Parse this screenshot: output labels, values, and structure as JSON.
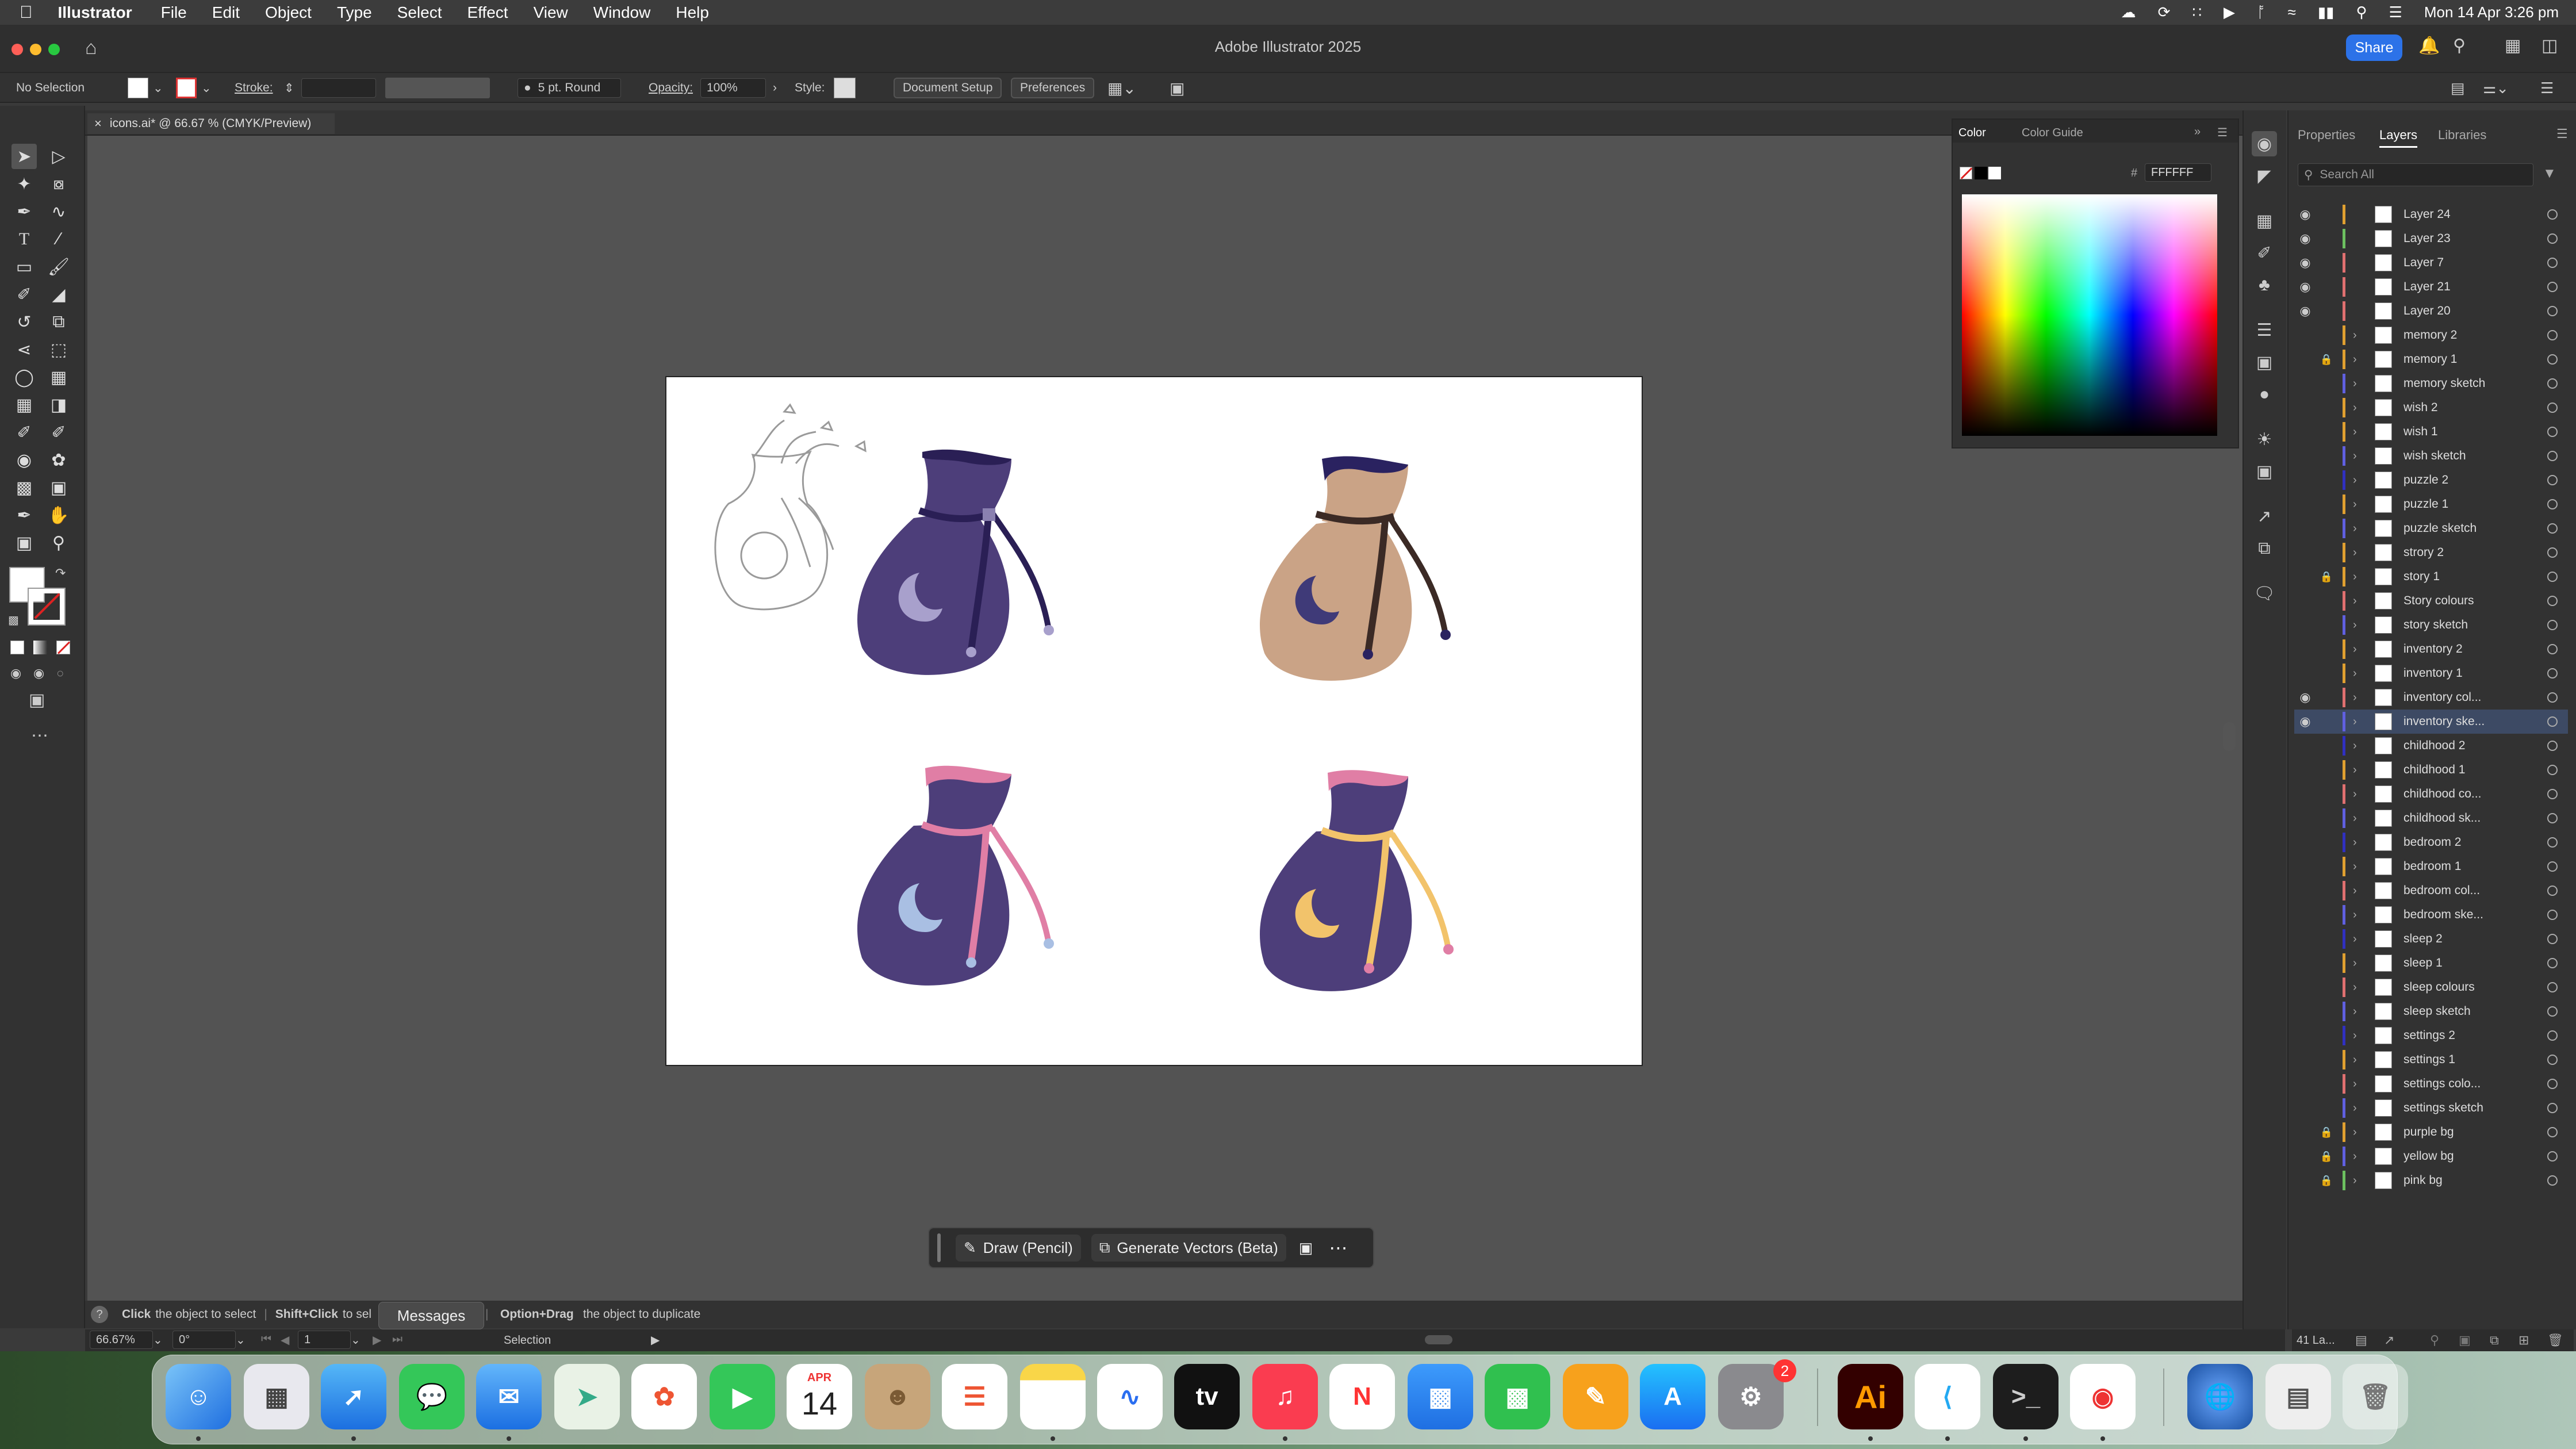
{
  "menubar": {
    "app": "Illustrator",
    "items": [
      "File",
      "Edit",
      "Object",
      "Type",
      "Select",
      "Effect",
      "View",
      "Window",
      "Help"
    ],
    "datetime": "Mon 14 Apr  3:26 pm"
  },
  "window": {
    "title": "Adobe Illustrator 2025",
    "share_label": "Share"
  },
  "control": {
    "selection": "No Selection",
    "stroke_label": "Stroke:",
    "brush": "5 pt. Round",
    "opacity_label": "Opacity:",
    "opacity_value": "100%",
    "style_label": "Style:",
    "doc_setup": "Document Setup",
    "preferences": "Preferences"
  },
  "tab": {
    "label": "icons.ai* @ 66.67 % (CMYK/Preview)"
  },
  "color_panel": {
    "tab_color": "Color",
    "tab_guide": "Color Guide",
    "hex_label": "#",
    "hex": "FFFFFF"
  },
  "right_panel": {
    "tabs": [
      "Properties",
      "Layers",
      "Libraries"
    ],
    "active": "Layers",
    "search_placeholder": "Search All",
    "count": "41 La..."
  },
  "layers": [
    {
      "name": "Layer 24",
      "eye": true,
      "lock": false,
      "color": "#e0a030"
    },
    {
      "name": "Layer 23",
      "eye": true,
      "lock": false,
      "color": "#6cc060"
    },
    {
      "name": "Layer 7",
      "eye": true,
      "lock": false,
      "color": "#e07070"
    },
    {
      "name": "Layer 21",
      "eye": true,
      "lock": false,
      "color": "#e07070"
    },
    {
      "name": "Layer 20",
      "eye": true,
      "lock": false,
      "color": "#e07070"
    },
    {
      "name": "memory 2",
      "eye": false,
      "lock": false,
      "color": "#e0a030"
    },
    {
      "name": "memory 1",
      "eye": false,
      "lock": true,
      "color": "#e0a030"
    },
    {
      "name": "memory sketch",
      "eye": false,
      "lock": false,
      "color": "#6060e0"
    },
    {
      "name": "wish 2",
      "eye": false,
      "lock": false,
      "color": "#e0a030"
    },
    {
      "name": "wish 1",
      "eye": false,
      "lock": false,
      "color": "#e0a030"
    },
    {
      "name": "wish sketch",
      "eye": false,
      "lock": false,
      "color": "#6060e0"
    },
    {
      "name": "puzzle 2",
      "eye": false,
      "lock": false,
      "color": "#3030c0"
    },
    {
      "name": "puzzle 1",
      "eye": false,
      "lock": false,
      "color": "#e0a030"
    },
    {
      "name": "puzzle sketch",
      "eye": false,
      "lock": false,
      "color": "#6060e0"
    },
    {
      "name": "strory 2",
      "eye": false,
      "lock": false,
      "color": "#e0a030"
    },
    {
      "name": "story 1",
      "eye": false,
      "lock": true,
      "color": "#e0a030"
    },
    {
      "name": "Story colours",
      "eye": false,
      "lock": false,
      "color": "#e07070"
    },
    {
      "name": "story sketch",
      "eye": false,
      "lock": false,
      "color": "#6060e0"
    },
    {
      "name": "inventory 2",
      "eye": false,
      "lock": false,
      "color": "#e0a030"
    },
    {
      "name": "inventory 1",
      "eye": false,
      "lock": false,
      "color": "#e0a030"
    },
    {
      "name": "inventory col...",
      "eye": true,
      "lock": false,
      "color": "#e07070"
    },
    {
      "name": "inventory ske...",
      "eye": true,
      "lock": false,
      "color": "#6060e0",
      "selected": true
    },
    {
      "name": "childhood 2",
      "eye": false,
      "lock": false,
      "color": "#3030c0"
    },
    {
      "name": "childhood 1",
      "eye": false,
      "lock": false,
      "color": "#e0a030"
    },
    {
      "name": "childhood co...",
      "eye": false,
      "lock": false,
      "color": "#e07070"
    },
    {
      "name": "childhood sk...",
      "eye": false,
      "lock": false,
      "color": "#6060e0"
    },
    {
      "name": "bedroom 2",
      "eye": false,
      "lock": false,
      "color": "#3030c0"
    },
    {
      "name": "bedroom 1",
      "eye": false,
      "lock": false,
      "color": "#e0a030"
    },
    {
      "name": "bedroom col...",
      "eye": false,
      "lock": false,
      "color": "#e07070"
    },
    {
      "name": "bedroom ske...",
      "eye": false,
      "lock": false,
      "color": "#6060e0"
    },
    {
      "name": "sleep 2",
      "eye": false,
      "lock": false,
      "color": "#3030c0"
    },
    {
      "name": "sleep 1",
      "eye": false,
      "lock": false,
      "color": "#e0a030"
    },
    {
      "name": "sleep colours",
      "eye": false,
      "lock": false,
      "color": "#e07070"
    },
    {
      "name": "sleep sketch",
      "eye": false,
      "lock": false,
      "color": "#6060e0"
    },
    {
      "name": "settings 2",
      "eye": false,
      "lock": false,
      "color": "#3030c0"
    },
    {
      "name": "settings 1",
      "eye": false,
      "lock": false,
      "color": "#e0a030"
    },
    {
      "name": "settings colo...",
      "eye": false,
      "lock": false,
      "color": "#e07070"
    },
    {
      "name": "settings sketch",
      "eye": false,
      "lock": false,
      "color": "#6060e0"
    },
    {
      "name": "purple bg",
      "eye": false,
      "lock": true,
      "color": "#e0a030"
    },
    {
      "name": "yellow bg",
      "eye": false,
      "lock": true,
      "color": "#6060e0"
    },
    {
      "name": "pink bg",
      "eye": false,
      "lock": true,
      "color": "#6cc060"
    }
  ],
  "context_bar": {
    "draw": "Draw (Pencil)",
    "generate": "Generate Vectors (Beta)"
  },
  "status": {
    "tip_click": "Click",
    "tip1": "the object to select",
    "tip_shift": "Shift+Click",
    "tip2": "to sel",
    "tip_opt": "Option+Drag",
    "tip3": "the object to duplicate",
    "tooltip": "Messages"
  },
  "bottom": {
    "zoom": "66.67%",
    "rotation": "0°",
    "artboard": "1",
    "tool": "Selection"
  },
  "dock": {
    "calendar_month": "APR",
    "calendar_day": "14",
    "settings_badge": "2",
    "illustrator_label": "Ai"
  },
  "colors": {
    "bag_purple": "#4d3e7a",
    "bag_dark": "#2a1f55",
    "bag_tan": "#caa386",
    "pink": "#e07ea5",
    "yellow": "#f2c36b",
    "moon_light": "#a8a0cc",
    "moon_blue": "#a9bfe3"
  }
}
